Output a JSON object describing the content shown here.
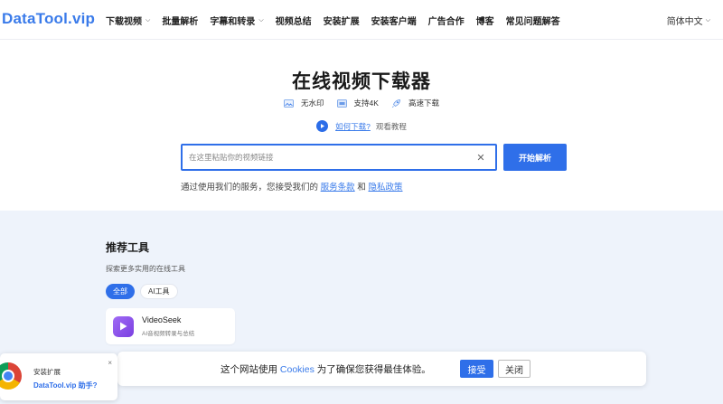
{
  "header": {
    "logo": "DataTool.vip",
    "nav": [
      {
        "label": "下载视频",
        "dropdown": true
      },
      {
        "label": "批量解析",
        "dropdown": false
      },
      {
        "label": "字幕和转录",
        "dropdown": true
      },
      {
        "label": "视频总结",
        "dropdown": false
      },
      {
        "label": "安装扩展",
        "dropdown": false
      },
      {
        "label": "安装客户端",
        "dropdown": false
      },
      {
        "label": "广告合作",
        "dropdown": false
      },
      {
        "label": "博客",
        "dropdown": false
      },
      {
        "label": "常见问题解答",
        "dropdown": false
      }
    ],
    "language": "简体中文"
  },
  "hero": {
    "title": "在线视频下载器",
    "features": [
      {
        "label": "无水印",
        "icon": "image-icon"
      },
      {
        "label": "支持4K",
        "icon": "4k-icon"
      },
      {
        "label": "高速下载",
        "icon": "rocket-icon"
      }
    ],
    "tutorial_link": "如何下载?",
    "tutorial_text": "观看教程"
  },
  "search": {
    "placeholder": "在这里粘贴你的视频链接",
    "value": "",
    "button": "开始解析"
  },
  "terms": {
    "prefix": "通过使用我们的服务，您接受我们的",
    "link1": "服务条款",
    "and": "和",
    "link2": "隐私政策"
  },
  "tools": {
    "title": "推荐工具",
    "subtitle": "探索更多实用的在线工具",
    "filters": [
      {
        "label": "全部",
        "active": true
      },
      {
        "label": "AI工具",
        "active": false
      }
    ],
    "cards": [
      {
        "name": "VideoSeek",
        "desc": "AI音视频转录与总结",
        "icon": "play-logo-icon"
      }
    ]
  },
  "cookie": {
    "text_prefix": "这个网站使用",
    "text_highlight": "Cookies",
    "text_suffix": "为了确保您获得最佳体验。",
    "accept": "接受",
    "close": "关闭"
  },
  "extension_popup": {
    "title": "安装扩展",
    "link": "DataTool.vip 助手?",
    "close": "×"
  },
  "colors": {
    "accent": "#2f6fe9",
    "logo": "#3a7bea",
    "section_bg": "#eef3fb"
  }
}
